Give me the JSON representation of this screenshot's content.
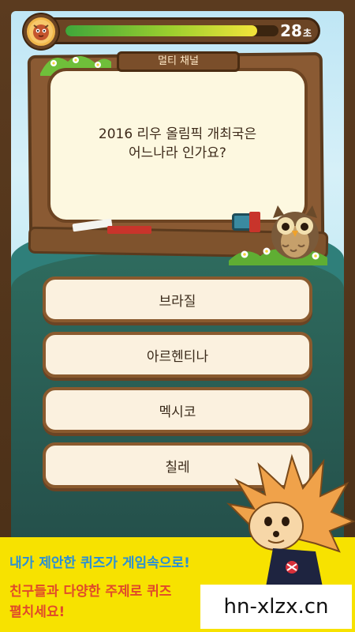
{
  "timer": {
    "value": "28",
    "unit": "초",
    "progress": 0.9
  },
  "board": {
    "channel": "멀티 채널",
    "question_line1": "2016 리우 올림픽 개최국은",
    "question_line2": "어느나라 인가요?"
  },
  "answers": [
    {
      "label": "브라질"
    },
    {
      "label": "아르헨티나"
    },
    {
      "label": "멕시코"
    },
    {
      "label": "칠레"
    }
  ],
  "promo": {
    "line1": "내가 제안한 퀴즈가 게임속으로!",
    "line2": "친구들과 다양한 주제로 퀴즈",
    "line3": "펼치세요!"
  },
  "watermark": "hn-xlzx.cn",
  "colors": {
    "frame": "#5b3b1f",
    "promo_bg": "#f7e200",
    "promo_blue": "#2a8fd6",
    "promo_red": "#e04a2a",
    "answer_bg": "#fbf1df"
  },
  "icons": [
    "quiz-mascot-icon",
    "owl-icon",
    "hedgehog-character-icon"
  ]
}
